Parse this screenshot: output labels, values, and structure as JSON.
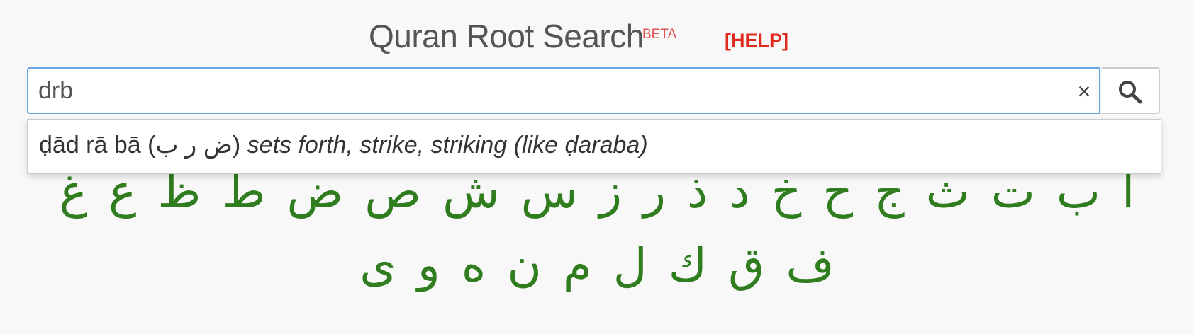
{
  "header": {
    "title": "Quran Root Search",
    "beta": "BETA",
    "help": "[HELP]"
  },
  "search": {
    "value": "drb",
    "clear_label": "×"
  },
  "suggestion": {
    "translit": "ḍād rā bā",
    "arabic": "(ض ر ب)",
    "meaning": "sets forth, strike, striking (like ḍaraba)"
  },
  "colors": {
    "accent": "#66a6e0",
    "help": "#e02a1e",
    "letters": "#2f7d1f"
  },
  "letters_row1": [
    "ا",
    "ب",
    "ت",
    "ث",
    "ج",
    "ح",
    "خ",
    "د",
    "ذ",
    "ر",
    "ز",
    "س",
    "ش",
    "ص",
    "ض",
    "ط",
    "ظ",
    "ع",
    "غ"
  ],
  "letters_row2": [
    "ف",
    "ق",
    "ك",
    "ل",
    "م",
    "ن",
    "ه",
    "و",
    "ى"
  ]
}
